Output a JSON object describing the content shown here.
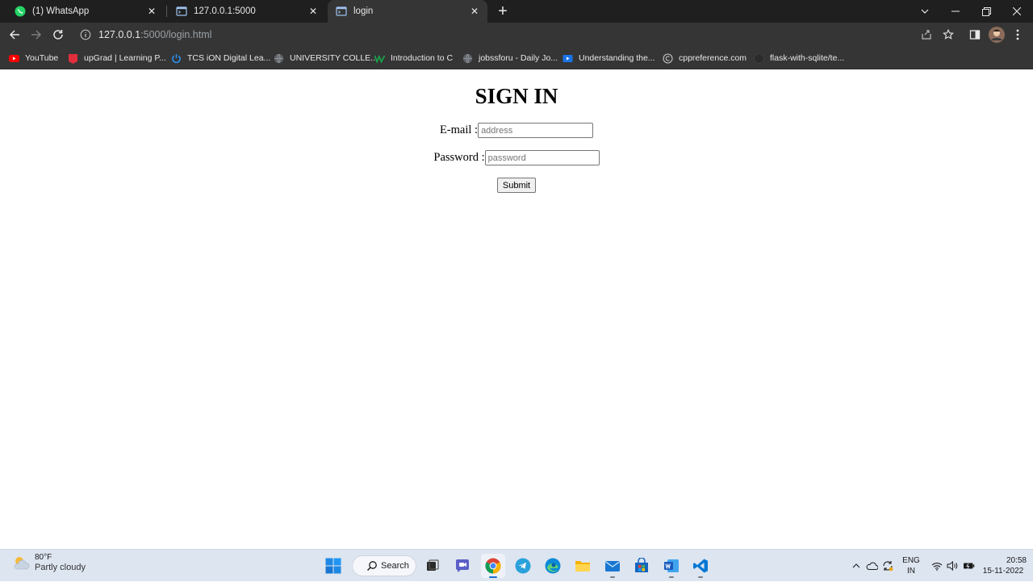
{
  "browser": {
    "tabs": [
      {
        "title": "(1) WhatsApp",
        "icon": "whatsapp-icon",
        "active": false
      },
      {
        "title": "127.0.0.1:5000",
        "icon": "terminal-icon",
        "active": false
      },
      {
        "title": "login",
        "icon": "terminal-icon",
        "active": true
      }
    ],
    "url_host": "127.0.0.1",
    "url_path": ":5000/login.html",
    "bookmarks": [
      {
        "label": "YouTube",
        "icon": "youtube-icon"
      },
      {
        "label": "upGrad | Learning P...",
        "icon": "upgrad-icon"
      },
      {
        "label": "TCS iON Digital Lea...",
        "icon": "power-icon"
      },
      {
        "label": "UNIVERSITY COLLE...",
        "icon": "globe-icon"
      },
      {
        "label": "Introduction to C",
        "icon": "w-icon"
      },
      {
        "label": "jobssforu - Daily Jo...",
        "icon": "globe-icon"
      },
      {
        "label": "Understanding the...",
        "icon": "video-icon"
      },
      {
        "label": "cppreference.com",
        "icon": "cppreference-icon"
      },
      {
        "label": "flask-with-sqlite/te...",
        "icon": "github-icon"
      }
    ]
  },
  "page": {
    "title": "SIGN IN",
    "email_label": "E-mail :",
    "email_placeholder": "address",
    "password_label": "Password :",
    "password_placeholder": "password",
    "submit_label": "Submit"
  },
  "taskbar": {
    "weather_temp": "80°F",
    "weather_desc": "Partly cloudy",
    "search_label": "Search",
    "lang_line1": "ENG",
    "lang_line2": "IN",
    "time": "20:58",
    "date": "15-11-2022"
  }
}
